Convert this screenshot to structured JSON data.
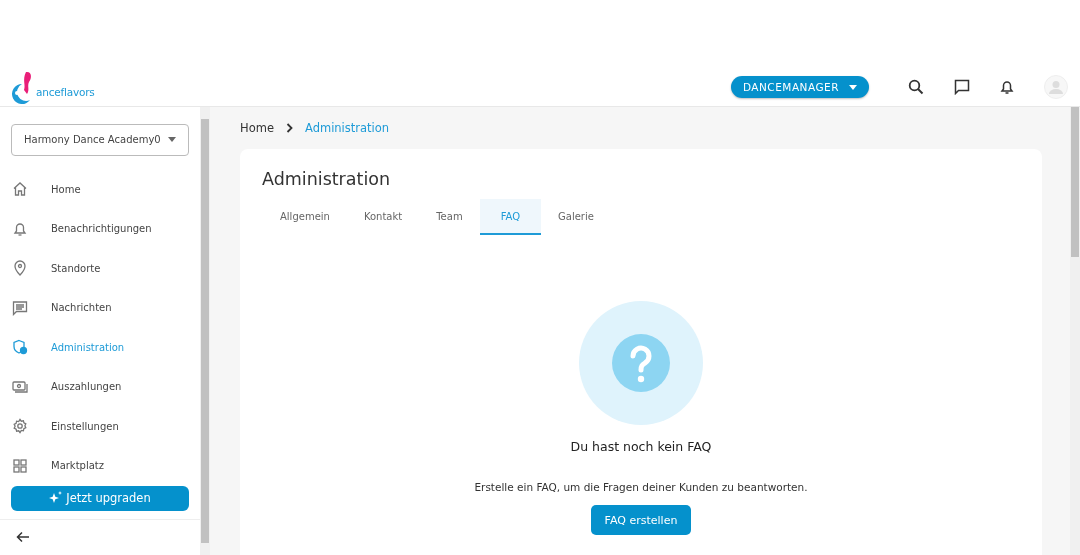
{
  "logo": {
    "text": "anceflavors"
  },
  "header": {
    "role_button": "DANCEMANAGER"
  },
  "sidebar": {
    "studio_select": {
      "value": "Harmony Dance Academy0"
    },
    "items": [
      {
        "label": "Home",
        "selected": false
      },
      {
        "label": "Benachrichtigungen",
        "selected": false
      },
      {
        "label": "Standorte",
        "selected": false
      },
      {
        "label": "Nachrichten",
        "selected": false
      },
      {
        "label": "Administration",
        "selected": true
      },
      {
        "label": "Auszahlungen",
        "selected": false
      },
      {
        "label": "Einstellungen",
        "selected": false
      },
      {
        "label": "Marktplatz",
        "selected": false
      }
    ],
    "upgrade_button": "Jetzt upgraden"
  },
  "breadcrumb": [
    "Home",
    "Administration"
  ],
  "page": {
    "title": "Administration",
    "tabs": [
      {
        "label": "Allgemein",
        "selected": false
      },
      {
        "label": "Kontakt",
        "selected": false
      },
      {
        "label": "Team",
        "selected": false
      },
      {
        "label": "FAQ",
        "selected": true
      },
      {
        "label": "Galerie",
        "selected": false
      }
    ],
    "empty_state": {
      "title": "Du hast noch kein FAQ",
      "text": "Erstelle ein FAQ, um die Fragen deiner Kunden zu beantworten.",
      "button": "FAQ erstellen"
    }
  }
}
